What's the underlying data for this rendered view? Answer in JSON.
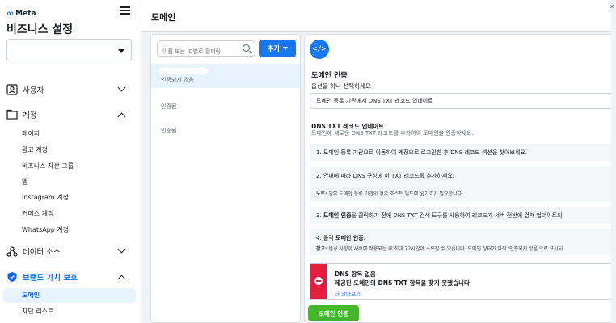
{
  "app": {
    "logo_text": "Meta",
    "business_title": "비즈니스 설정"
  },
  "sidebar": {
    "sections": [
      {
        "label": "사용자",
        "icon": "user-icon",
        "expanded": false
      },
      {
        "label": "계정",
        "icon": "folder-icon",
        "expanded": true,
        "items": [
          "페이지",
          "광고 계정",
          "비즈니스 자산 그룹",
          "앱",
          "Instagram 계정",
          "커머스 계정",
          "WhatsApp 계정"
        ]
      },
      {
        "label": "데이터 소스",
        "icon": "data-source-icon",
        "expanded": false
      },
      {
        "label": "브랜드 가치 보호",
        "icon": "shield-icon",
        "expanded": true,
        "active": true,
        "items": [
          "도메인",
          "차단 리스트"
        ],
        "active_item": "도메인"
      }
    ]
  },
  "header": {
    "title": "도메인"
  },
  "list": {
    "filter_placeholder": "이름 또는 ID별로 필터링",
    "add_label": "추가",
    "rows": [
      {
        "status": "인증되지 않음",
        "selected": true
      },
      {
        "status": "인증됨",
        "selected": false
      },
      {
        "status": "인증됨",
        "selected": false
      }
    ]
  },
  "detail": {
    "code_button_label": "</>",
    "title": "도메인 인증",
    "choose_label": "옵션을 하나 선택하세요",
    "selected_option": "도메인 등록 기관에서 DNS TXT 레코드 업데이트",
    "section_title": "DNS TXT 레코드 업데이트",
    "section_desc": "도메인에 새로운 DNS TXT 레코드를 추가하여 도메인을 인증하세요.",
    "steps": {
      "s1": "1. 도메인 등록 기관으로 이동하여 계정으로 로그인한 후 DNS 레코드 섹션을 찾아보세요.",
      "s2": "2. 안내에 따라 DNS 구성에 이 TXT 레코드를 추가하세요:",
      "s2_note_bold": "노트:",
      "s2_note": " 일부 도메인 등록 기관의 경우 호스트 필드에 @기호가 필요합니다.",
      "s3_prefix": "3. ",
      "s3_bold": "도메인 인증",
      "s3_rest": "을 클릭하기 전에 DNS TXT 검색 도구를 사용하여 레코드가 서버 전반에 걸쳐 업데이트되",
      "s4_prefix": "4. 클릭 ",
      "s4_bold": "도메인 인증",
      "s4_suffix": ".",
      "s4_note_bold": "참고:",
      "s4_note": " 변경 사항이 서버에 적용되는 데 최대 72시간이 소요될 수 있습니다. 도메인 상태가 아직 '인증되지 않음'으로 표시되"
    },
    "alert": {
      "title": "DNS 항목 없음",
      "body_prefix": "제공된 도메인의 ",
      "body_bold": "DNS TXT",
      "body_suffix": " 항목을 찾지 못했습니다",
      "link": "더 알아보기."
    },
    "verify_button": "도메인 인증"
  },
  "colors": {
    "accent": "#1877f2",
    "success": "#42b72a",
    "error": "#e41e3f",
    "selected_bg": "#e7f3ff"
  }
}
